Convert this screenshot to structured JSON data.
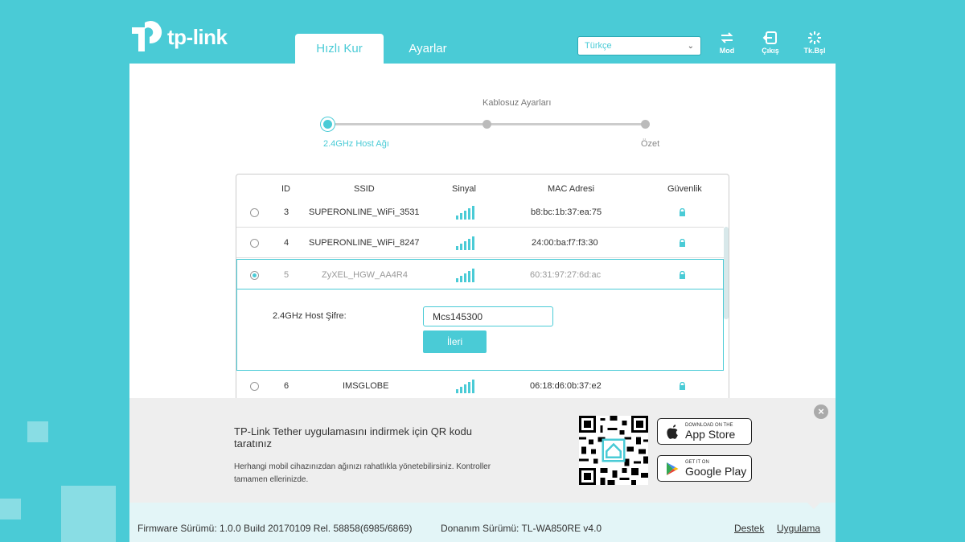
{
  "brand": {
    "logo_text": "tp-link",
    "accent": "#4acbd6"
  },
  "nav": {
    "tabs": [
      {
        "label": "Hızlı Kur",
        "active": true
      },
      {
        "label": "Ayarlar",
        "active": false
      }
    ],
    "language": "Türkçe",
    "actions": [
      {
        "label": "Mod",
        "icon": "mode-switch-icon"
      },
      {
        "label": "Çıkış",
        "icon": "logout-icon"
      },
      {
        "label": "Tk.Bşl",
        "icon": "reboot-icon"
      }
    ]
  },
  "wizard": {
    "middle_title": "Kablosuz Ayarları",
    "steps": [
      {
        "label": "2.4GHz Host Ağı",
        "active": true
      },
      {
        "label": "",
        "active": false
      },
      {
        "label": "Özet",
        "active": false
      }
    ]
  },
  "table": {
    "headers": {
      "id": "ID",
      "ssid": "SSID",
      "signal": "Sinyal",
      "mac": "MAC Adresi",
      "security": "Güvenlik"
    },
    "rows": [
      {
        "id": "3",
        "ssid": "SUPERONLINE_WiFi_3531",
        "mac": "b8:bc:1b:37:ea:75",
        "selected": false,
        "secured": true
      },
      {
        "id": "4",
        "ssid": "SUPERONLINE_WiFi_8247",
        "mac": "24:00:ba:f7:f3:30",
        "selected": false,
        "secured": true
      },
      {
        "id": "5",
        "ssid": "ZyXEL_HGW_AA4R4",
        "mac": "60:31:97:27:6d:ac",
        "selected": true,
        "secured": true
      },
      {
        "id": "6",
        "ssid": "IMSGLOBE",
        "mac": "06:18:d6:0b:37:e2",
        "selected": false,
        "secured": true
      }
    ],
    "password_label": "2.4GHz Host Şifre:",
    "password_value": "Mcs145300",
    "next_label": "İleri"
  },
  "promo": {
    "title": "TP-Link Tether uygulamasını indirmek için QR kodu taratınız",
    "description": "Herhangi mobil cihazınızdan ağınızı rahatlıkla yönetebilirsiniz. Kontroller tamamen ellerinizde.",
    "app_store_small": "DOWNLOAD ON THE",
    "app_store_big": "App Store",
    "google_small": "GET IT ON",
    "google_big": "Google Play"
  },
  "footer": {
    "firmware": "Firmware Sürümü: 1.0.0 Build 20170109 Rel. 58858(6985/6869)",
    "hardware": "Donanım Sürümü: TL-WA850RE v4.0",
    "links": [
      "Destek",
      "Uygulama"
    ]
  }
}
